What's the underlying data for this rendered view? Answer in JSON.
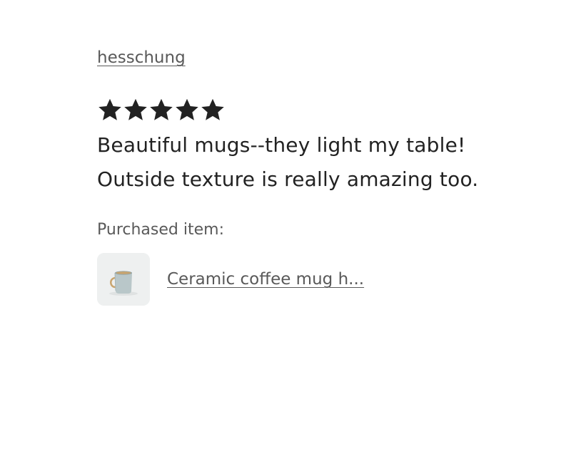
{
  "review": {
    "reviewer_name": "hesschung",
    "rating": 5,
    "rating_max": 5,
    "text": "Beautiful mugs--they light my table!\nOutside texture is really amazing too.",
    "purchased_label": "Purchased item:",
    "item": {
      "title": "Ceramic coffee mug h...",
      "thumbnail_icon": "mug-thumbnail"
    }
  },
  "colors": {
    "star": "#222222",
    "text_primary": "#222222",
    "text_secondary": "#595959",
    "thumb_background": "#eef0f0"
  }
}
